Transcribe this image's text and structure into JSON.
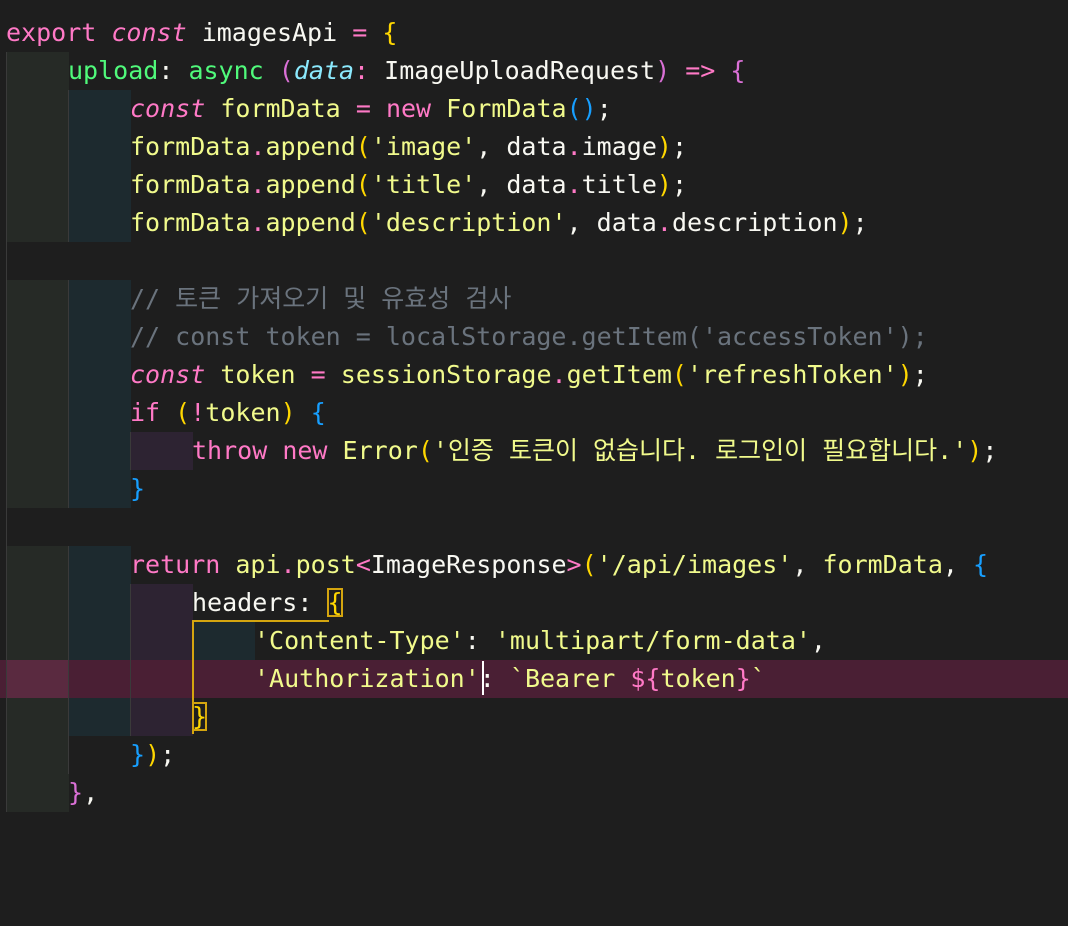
{
  "editor": {
    "theme_colors": {
      "background": "#1e1e1e",
      "active_line": "#4a1f34",
      "keyword": "#ff79c6",
      "string": "#f1fa8c",
      "comment": "#6a737d",
      "bracket_gold": "#ffd700",
      "bracket_magenta": "#da70d6",
      "bracket_blue": "#179fff",
      "match_outline": "#d4a50f"
    },
    "code": {
      "l1_export": "export",
      "l1_const": "const",
      "l1_name": "imagesApi",
      "l1_eq": "=",
      "l1_open": "{",
      "l2_key": "upload",
      "l2_colon": ":",
      "l2_async": "async",
      "l2_paren_open": "(",
      "l2_param": "data",
      "l2_param_colon": ":",
      "l2_type": "ImageUploadRequest",
      "l2_paren_close": ")",
      "l2_arrow": "=>",
      "l2_open": "{",
      "l3_const": "const",
      "l3_var": "formData",
      "l3_eq": "=",
      "l3_new": "new",
      "l3_cls": "FormData",
      "l3_call": "()",
      "l3_semi": ";",
      "l4_obj": "formData",
      "l4_dot": ".",
      "l4_fn": "append",
      "l4_open": "(",
      "l4_str": "'image'",
      "l4_comma": ",",
      "l4_data": "data",
      "l4_dot2": ".",
      "l4_prop": "image",
      "l4_close": ")",
      "l4_semi": ";",
      "l5_obj": "formData",
      "l5_dot": ".",
      "l5_fn": "append",
      "l5_open": "(",
      "l5_str": "'title'",
      "l5_comma": ",",
      "l5_data": "data",
      "l5_dot2": ".",
      "l5_prop": "title",
      "l5_close": ")",
      "l5_semi": ";",
      "l6_obj": "formData",
      "l6_dot": ".",
      "l6_fn": "append",
      "l6_open": "(",
      "l6_str": "'description'",
      "l6_comma": ",",
      "l6_data": "data",
      "l6_dot2": ".",
      "l6_prop": "description",
      "l6_close": ")",
      "l6_semi": ";",
      "l8_comment": "// 토큰 가져오기 및 유효성 검사",
      "l9_comment": "// const token = localStorage.getItem('accessToken');",
      "l10_const": "const",
      "l10_var": "token",
      "l10_eq": "=",
      "l10_obj": "sessionStorage",
      "l10_dot": ".",
      "l10_fn": "getItem",
      "l10_open": "(",
      "l10_str": "'refreshToken'",
      "l10_close": ")",
      "l10_semi": ";",
      "l11_if": "if",
      "l11_open": "(",
      "l11_not": "!",
      "l11_var": "token",
      "l11_close": ")",
      "l11_brace": "{",
      "l12_throw": "throw",
      "l12_new": "new",
      "l12_cls": "Error",
      "l12_open": "(",
      "l12_str": "'인증 토큰이 없습니다. 로그인이 필요합니다.'",
      "l12_close": ")",
      "l12_semi": ";",
      "l13_brace": "}",
      "l15_return": "return",
      "l15_obj": "api",
      "l15_dot": ".",
      "l15_fn": "post",
      "l15_lt": "<",
      "l15_type": "ImageResponse",
      "l15_gt": ">",
      "l15_open": "(",
      "l15_str": "'/api/images'",
      "l15_comma": ",",
      "l15_var": "formData",
      "l15_comma2": ",",
      "l15_brace": "{",
      "l16_key": "headers",
      "l16_colon": ":",
      "l16_brace": "{",
      "l17_key": "'Content-Type'",
      "l17_colon": ":",
      "l17_val": "'multipart/form-data'",
      "l17_comma": ",",
      "l18_key": "'Authorization'",
      "l18_colon": ":",
      "l18_tpl_start": "`Bearer ",
      "l18_tpl_open": "${",
      "l18_tpl_var": "token",
      "l18_tpl_close": "}",
      "l18_tpl_end": "`",
      "l19_brace": "}",
      "l20_brace": "}",
      "l20_paren": ")",
      "l20_semi": ";",
      "l21_brace": "}",
      "l21_comma": ","
    }
  }
}
